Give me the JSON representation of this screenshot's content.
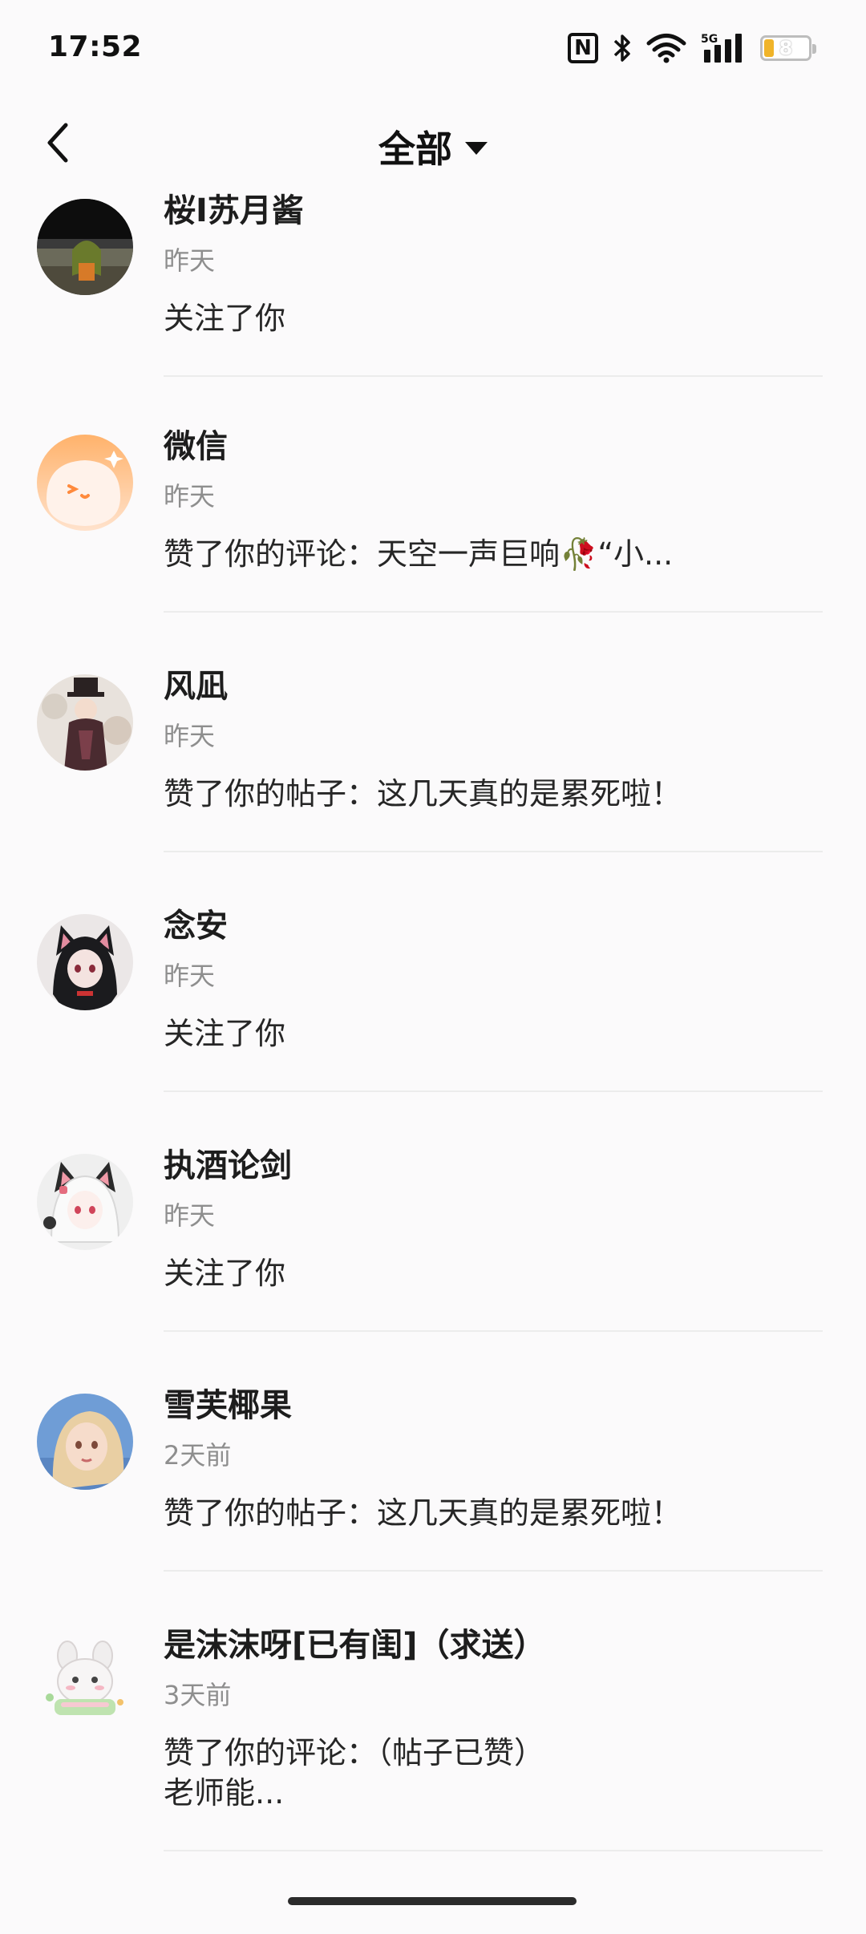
{
  "status_bar": {
    "time": "17:52",
    "network": "5G",
    "nfc_label": "N",
    "battery": "8",
    "icons": [
      "nfc-icon",
      "bluetooth-icon",
      "wifi-icon",
      "signal-5g-icon",
      "battery-icon"
    ]
  },
  "header": {
    "title": "全部",
    "back_icon": "chevron-left-icon",
    "dropdown_icon": "caret-down-icon"
  },
  "notifications": [
    {
      "name": "桜I苏月酱",
      "time": "昨天",
      "content": "关注了你",
      "avatar": "anime-girl-avatar"
    },
    {
      "name": "微信",
      "time": "昨天",
      "content": "赞了你的评论：天空一声巨响🥀“小...",
      "avatar": "orange-mascot-avatar"
    },
    {
      "name": "风凪",
      "time": "昨天",
      "content": "赞了你的帖子：这几天真的是累死啦！",
      "avatar": "top-hat-character-avatar"
    },
    {
      "name": "念安",
      "time": "昨天",
      "content": "关注了你",
      "avatar": "cat-ear-girl-avatar"
    },
    {
      "name": "执酒论剑",
      "time": "昨天",
      "content": "关注了你",
      "avatar": "white-hair-cat-girl-avatar"
    },
    {
      "name": "雪芙椰果",
      "time": "2天前",
      "content": "赞了你的帖子：这几天真的是累死啦！",
      "avatar": "blonde-girl-avatar"
    },
    {
      "name": "是沫沫呀[已有闺]（求送）",
      "time": "3天前",
      "content": "赞了你的评论：（帖子已赞）\n老师能...",
      "avatar": "cute-bunny-avatar"
    }
  ],
  "colors": {
    "background": "#fbfafb",
    "text_primary": "#1d1d1d",
    "text_secondary": "#8e8e8e",
    "divider": "#ececec",
    "battery_accent": "#f0b429"
  }
}
